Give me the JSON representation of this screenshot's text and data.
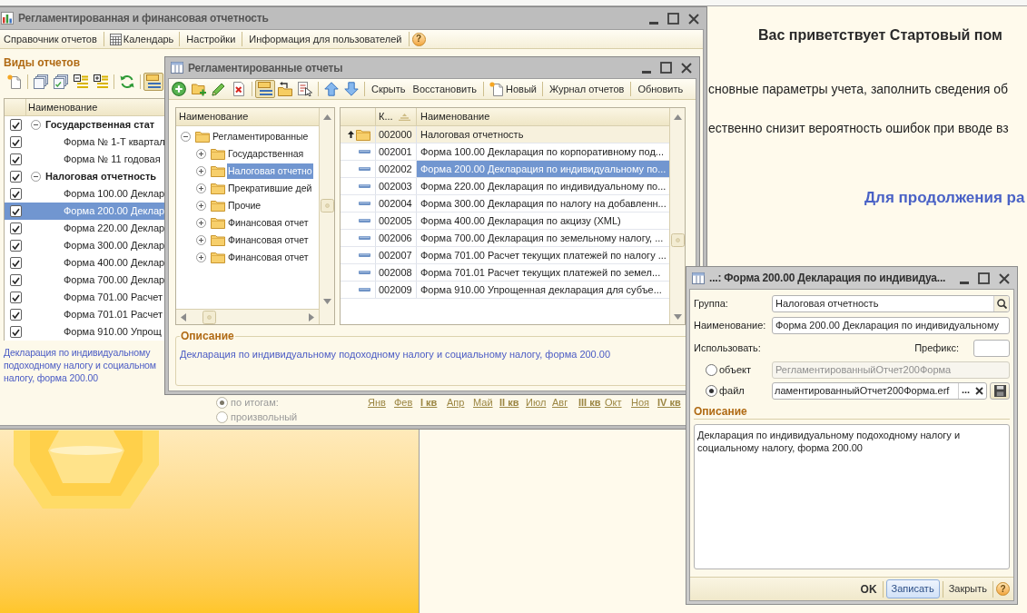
{
  "main_window": {
    "title": "Регламентированная и финансовая отчетность",
    "toolbar": [
      {
        "kind": "text",
        "label": "Справочник отчетов"
      },
      {
        "kind": "calendar",
        "label": "Календарь"
      },
      {
        "kind": "text",
        "label": "Настройки"
      },
      {
        "kind": "text",
        "label": "Информация для пользователей"
      },
      {
        "kind": "help",
        "label": "?"
      }
    ],
    "section_title": "Виды отчетов",
    "list_toolbar": [
      [
        {
          "kind": "new",
          "pressed": false
        }
      ],
      [
        {
          "kind": "copy",
          "pressed": false
        },
        {
          "kind": "check_all",
          "pressed": false
        },
        {
          "kind": "collapse",
          "pressed": false
        },
        {
          "kind": "expand",
          "pressed": false
        }
      ],
      [
        {
          "kind": "refresh",
          "pressed": false
        }
      ],
      [
        {
          "kind": "hierarchy",
          "pressed": true
        }
      ]
    ],
    "list": {
      "column": "Наименование",
      "rows": [
        {
          "kind": "group",
          "label": "Государственная стат",
          "checked": true,
          "expanded": true,
          "selected": false,
          "children": [
            {
              "kind": "item",
              "label": "Форма № 1-Т квартал",
              "checked": true,
              "selected": false
            },
            {
              "kind": "item",
              "label": "Форма № 11 годовая",
              "checked": true,
              "selected": false
            }
          ]
        },
        {
          "kind": "group",
          "label": "Налоговая отчетность",
          "checked": true,
          "expanded": true,
          "selected": false,
          "children": [
            {
              "kind": "item",
              "label": "Форма 100.00 Деклар",
              "checked": true,
              "selected": false
            },
            {
              "kind": "item",
              "label": "Форма 200.00 Деклар",
              "checked": true,
              "selected": true
            },
            {
              "kind": "item",
              "label": "Форма 220.00 Деклар",
              "checked": true,
              "selected": false
            },
            {
              "kind": "item",
              "label": "Форма 300.00 Деклар",
              "checked": true,
              "selected": false
            },
            {
              "kind": "item",
              "label": "Форма 400.00 Деклар",
              "checked": true,
              "selected": false
            },
            {
              "kind": "item",
              "label": "Форма 700.00 Деклар",
              "checked": true,
              "selected": false
            },
            {
              "kind": "item",
              "label": "Форма 701.00 Расчет",
              "checked": true,
              "selected": false
            },
            {
              "kind": "item",
              "label": "Форма 701.01 Расчет",
              "checked": true,
              "selected": false
            },
            {
              "kind": "item",
              "label": "Форма 910.00 Упрощ",
              "checked": true,
              "selected": false
            }
          ]
        }
      ]
    },
    "description": "Декларация по индивидуальному\nподоходному налогу и социальном\nналогу, форма 200.00",
    "period_options": [
      {
        "label": "по итогам:",
        "selected": true,
        "disabled": true
      },
      {
        "label": "произвольный",
        "selected": false,
        "disabled": true
      }
    ],
    "periods": [
      {
        "kind": "month",
        "label": "Янв"
      },
      {
        "kind": "month",
        "label": "Фев"
      },
      {
        "kind": "quarter",
        "label": "I кв"
      },
      {
        "kind": "month",
        "label": "Апр"
      },
      {
        "kind": "month",
        "label": "Май"
      },
      {
        "kind": "quarter",
        "label": "II кв"
      },
      {
        "kind": "month",
        "label": "Июл"
      },
      {
        "kind": "month",
        "label": "Авг"
      },
      {
        "kind": "quarter",
        "label": "III кв"
      },
      {
        "kind": "month",
        "label": "Окт"
      },
      {
        "kind": "month",
        "label": "Ноя"
      },
      {
        "kind": "quarter",
        "label": "IV кв"
      }
    ]
  },
  "reports_window": {
    "title": "Регламентированные отчеты",
    "toolbar": [
      [
        {
          "kind": "add",
          "pressed": false
        },
        {
          "kind": "add_folder",
          "pressed": false
        },
        {
          "kind": "edit",
          "pressed": false
        },
        {
          "kind": "delete",
          "pressed": false
        }
      ],
      [
        {
          "kind": "hierarchy",
          "pressed": true
        },
        {
          "kind": "level_up",
          "pressed": false
        },
        {
          "kind": "select",
          "pressed": false
        }
      ],
      [
        {
          "kind": "move_up",
          "pressed": false
        },
        {
          "kind": "move_down",
          "pressed": false
        }
      ],
      [
        {
          "kind": "text",
          "label": "Скрыть",
          "pressed": false
        },
        {
          "kind": "text",
          "label": "Восстановить",
          "pressed": false
        }
      ],
      [
        {
          "kind": "new",
          "label": "Новый",
          "pressed": false
        }
      ],
      [
        {
          "kind": "text",
          "label": "Журнал отчетов",
          "pressed": false
        }
      ],
      [
        {
          "kind": "text",
          "label": "Обновить",
          "pressed": false
        }
      ]
    ],
    "tree": {
      "column": "Наименование",
      "items": [
        {
          "label": "Регламентированные",
          "expanded": true,
          "selected": false,
          "children": [
            {
              "label": "Государственная",
              "expanded": false,
              "selected": false
            },
            {
              "label": "Налоговая отчетно",
              "expanded": false,
              "selected": true
            },
            {
              "label": "Прекратившие дей",
              "expanded": false,
              "selected": false
            },
            {
              "label": "Прочие",
              "expanded": false,
              "selected": false
            },
            {
              "label": "Финансовая отчет",
              "expanded": false,
              "selected": false
            },
            {
              "label": "Финансовая отчет",
              "expanded": false,
              "selected": false
            },
            {
              "label": "Финансовая отчет",
              "expanded": false,
              "selected": false
            }
          ]
        }
      ]
    },
    "table": {
      "columns": [
        "К...",
        "Наименование"
      ],
      "rows": [
        {
          "kind": "parent_folder",
          "code": "002000",
          "name": "Налоговая отчетность",
          "selected": false
        },
        {
          "kind": "item",
          "code": "002001",
          "name": "Форма 100.00 Декларация по корпоративному под...",
          "selected": false
        },
        {
          "kind": "item",
          "code": "002002",
          "name": "Форма 200.00 Декларация по индивидуальному по...",
          "selected": true
        },
        {
          "kind": "item",
          "code": "002003",
          "name": "Форма 220.00 Декларация по индивидуальному по...",
          "selected": false
        },
        {
          "kind": "item",
          "code": "002004",
          "name": "Форма 300.00 Декларация по налогу на добавленн...",
          "selected": false
        },
        {
          "kind": "item",
          "code": "002005",
          "name": "Форма 400.00 Декларация по акцизу (XML)",
          "selected": false
        },
        {
          "kind": "item",
          "code": "002006",
          "name": "Форма 700.00 Декларация по земельному налогу, ...",
          "selected": false
        },
        {
          "kind": "item",
          "code": "002007",
          "name": "Форма 701.00 Расчет текущих платежей по налогу ...",
          "selected": false
        },
        {
          "kind": "item",
          "code": "002008",
          "name": "Форма 701.01 Расчет текущих платежей по земел...",
          "selected": false
        },
        {
          "kind": "item",
          "code": "002009",
          "name": "Форма 910.00 Упрощенная декларация для субъе...",
          "selected": false
        }
      ]
    },
    "description": {
      "title": "Описание",
      "text": "Декларация по индивидуальному подоходному налогу и социальному налогу, форма 200.00"
    }
  },
  "report_form": {
    "title": "...: Форма 200.00 Декларация по индивидуа...",
    "group": {
      "label": "Группа:",
      "value": "Налоговая отчетность"
    },
    "name": {
      "label": "Наименование:",
      "value": "Форма 200.00 Декларация по индивидуальному"
    },
    "use_label": "Использовать:",
    "prefix_label": "Префикс:",
    "sources": [
      {
        "kind": "object",
        "label": "объект",
        "selected": false,
        "disabled": true,
        "value": "РегламентированныйОтчет200Форма"
      },
      {
        "kind": "file",
        "label": "файл",
        "selected": true,
        "disabled": false,
        "value": "ламентированныйОтчет200Форма.erf",
        "browse": "..."
      }
    ],
    "description": {
      "title": "Описание",
      "text": "Декларация по индивидуальному подоходному налогу и социальному налогу, форма 200.00"
    },
    "buttons": [
      {
        "kind": "default",
        "label": "OK"
      },
      {
        "kind": "focused",
        "label": "Записать"
      },
      {
        "kind": "plain",
        "label": "Закрыть"
      },
      {
        "kind": "help",
        "label": "?"
      }
    ]
  },
  "start_page": {
    "title": "Вас приветствует Стартовый пом",
    "lines": [
      "сновные параметры учета, заполнить сведения об",
      "ественно снизит вероятность ошибок при вводе вз"
    ],
    "link": "Для продолжения ра"
  }
}
